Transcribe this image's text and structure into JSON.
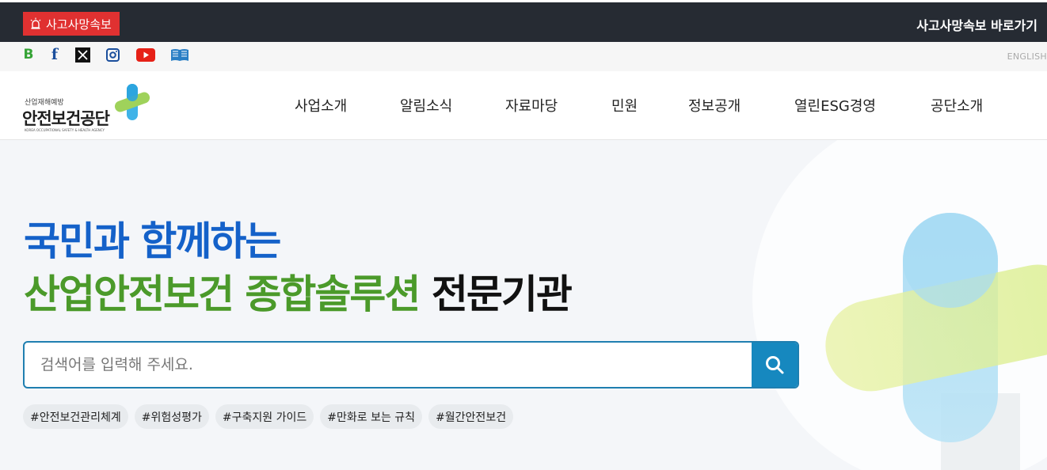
{
  "topbar": {
    "alert_label": "사고사망속보",
    "alert_link": "사고사망속보 바로가기"
  },
  "social": {
    "items": [
      {
        "name": "blog",
        "glyph": "B",
        "color": "#35a335"
      },
      {
        "name": "facebook",
        "glyph": "f",
        "color": "#1a4e9c"
      },
      {
        "name": "x",
        "glyph": "X",
        "color": "#111111"
      },
      {
        "name": "instagram",
        "glyph": "",
        "color": "#1a4e9c"
      },
      {
        "name": "youtube",
        "glyph": "",
        "color": "#e62117"
      },
      {
        "name": "ebook",
        "glyph": "",
        "color": "#2a7fc5"
      }
    ],
    "language": "ENGLISH"
  },
  "logo": {
    "sub": "산업재해예방",
    "name": "안전보건공단",
    "english": "KOREA OCCUPATIONAL SAFETY & HEALTH AGENCY"
  },
  "nav": {
    "items": [
      "사업소개",
      "알림소식",
      "자료마당",
      "민원",
      "정보공개",
      "열린ESG경영",
      "공단소개"
    ]
  },
  "hero": {
    "line1": "국민과 함께하는",
    "line2_green": "산업안전보건 종합솔루션",
    "line2_black": "전문기관"
  },
  "search": {
    "placeholder": "검색어를 입력해 주세요."
  },
  "tags": [
    "#안전보건관리체계",
    "#위험성평가",
    "#구축지원 가이드",
    "#만화로 보는 규칙",
    "#월간안전보건"
  ],
  "colors": {
    "alert": "#e03131",
    "topbar": "#262b33",
    "headline_blue": "#1461c9",
    "headline_green": "#4b9a2a",
    "search_button": "#1688bf"
  }
}
